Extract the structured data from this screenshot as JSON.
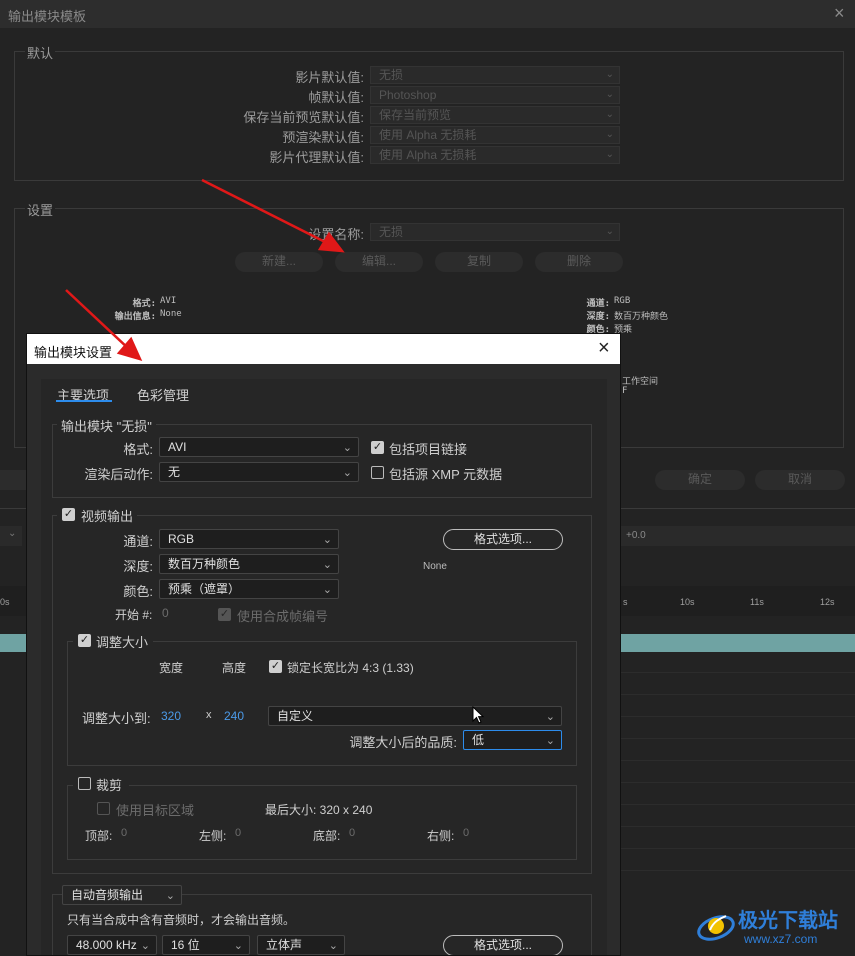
{
  "bg": {
    "title": "输出模块模板",
    "defaults_group": "默认",
    "defaults": [
      {
        "label": "影片默认值:",
        "value": "无损"
      },
      {
        "label": "帧默认值:",
        "value": "Photoshop"
      },
      {
        "label": "保存当前预览默认值:",
        "value": "保存当前预览"
      },
      {
        "label": "预渲染默认值:",
        "value": "使用 Alpha 无损耗"
      },
      {
        "label": "影片代理默认值:",
        "value": "使用 Alpha 无损耗"
      }
    ],
    "settings_group": "设置",
    "settings_name_label": "设置名称:",
    "settings_name_value": "无损",
    "buttons": [
      "新建...",
      "编辑...",
      "复制",
      "删除"
    ],
    "info_left": [
      {
        "k": "格式:",
        "v": "AVI"
      },
      {
        "k": "输出信息:",
        "v": "None"
      }
    ],
    "info_right": [
      {
        "k": "通道:",
        "v": "RGB"
      },
      {
        "k": "深度:",
        "v": "数百万种颜色"
      },
      {
        "k": "颜色:",
        "v": "预乘"
      }
    ],
    "info_frag_1": "工作空间",
    "info_frag_2": "F",
    "ok": "确定",
    "cancel": "取消",
    "timeline_value": "+0.0",
    "ruler": [
      "0s",
      "s",
      "10s",
      "11s",
      "12s"
    ]
  },
  "dialog": {
    "title": "输出模块设置",
    "tabs": [
      "主要选项",
      "色彩管理"
    ],
    "module_group": "输出模块 \"无损\"",
    "format_label": "格式:",
    "format_value": "AVI",
    "include_project_link": "包括项目链接",
    "post_render_label": "渲染后动作:",
    "post_render_value": "无",
    "include_xmp": "包括源 XMP 元数据",
    "video_output": "视频输出",
    "channel_label": "通道:",
    "channel_value": "RGB",
    "depth_label": "深度:",
    "depth_value": "数百万种颜色",
    "color_label": "颜色:",
    "color_value": "预乘（遮罩）",
    "start_label": "开始 #:",
    "start_value": "0",
    "use_comp_frame": "使用合成帧编号",
    "format_options": "格式选项...",
    "codec_info": "None",
    "resize": "调整大小",
    "width_label": "宽度",
    "height_label": "高度",
    "lock_aspect": "锁定长宽比为 4:3 (1.33)",
    "resize_to_label": "调整大小到:",
    "resize_w": "320",
    "resize_x": "x",
    "resize_h": "240",
    "resize_preset": "自定义",
    "quality_label": "调整大小后的品质:",
    "quality_value": "低",
    "crop": "裁剪",
    "use_roi": "使用目标区域",
    "final_size": "最后大小: 320 x 240",
    "crop_top_label": "顶部:",
    "crop_top": "0",
    "crop_left_label": "左侧:",
    "crop_left": "0",
    "crop_bottom_label": "底部:",
    "crop_bottom": "0",
    "crop_right_label": "右侧:",
    "crop_right": "0",
    "audio_mode": "自动音频输出",
    "audio_note": "只有当合成中含有音频时，才会输出音频。",
    "sample_rate": "48.000 kHz",
    "bit_depth": "16 位",
    "channels": "立体声",
    "audio_format_options": "格式选项..."
  },
  "watermark": {
    "brand": "极光下载站",
    "url": "www.xz7.com"
  }
}
